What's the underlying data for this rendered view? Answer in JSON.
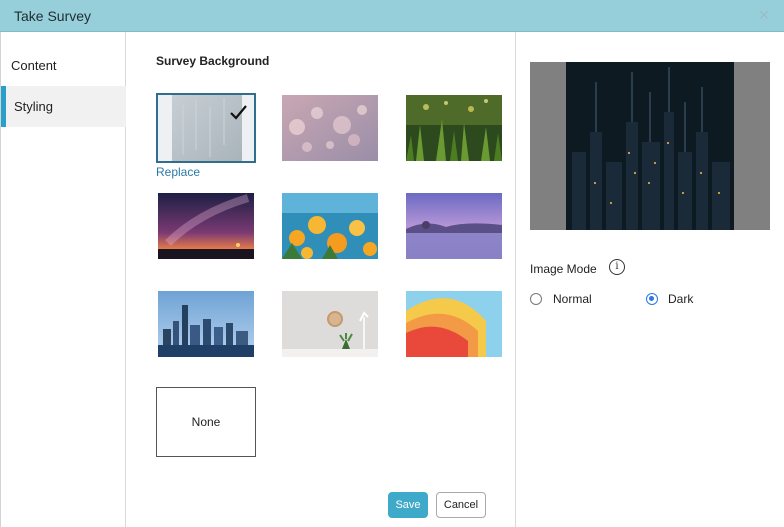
{
  "window": {
    "title": "Take Survey",
    "close_glyph": "×"
  },
  "sidebar": {
    "items": [
      {
        "label": "Content"
      },
      {
        "label": "Styling"
      }
    ]
  },
  "main": {
    "section_title": "Survey Background",
    "replace_label": "Replace",
    "none_label": "None",
    "save_label": "Save",
    "cancel_label": "Cancel",
    "backgrounds": [
      {
        "name": "rain-glass",
        "selected": true
      },
      {
        "name": "bokeh-lights"
      },
      {
        "name": "green-grass-dew"
      },
      {
        "name": "milky-way-sunset"
      },
      {
        "name": "orange-flowers"
      },
      {
        "name": "purple-lake"
      },
      {
        "name": "city-skyline"
      },
      {
        "name": "wall-clock-lamp"
      },
      {
        "name": "colorful-paper-curve"
      }
    ]
  },
  "right": {
    "preview_image": "dark-city-lights",
    "image_mode_label": "Image Mode",
    "info_glyph": "i",
    "modes": [
      {
        "label": "Normal",
        "checked": false
      },
      {
        "label": "Dark",
        "checked": true
      }
    ]
  }
}
